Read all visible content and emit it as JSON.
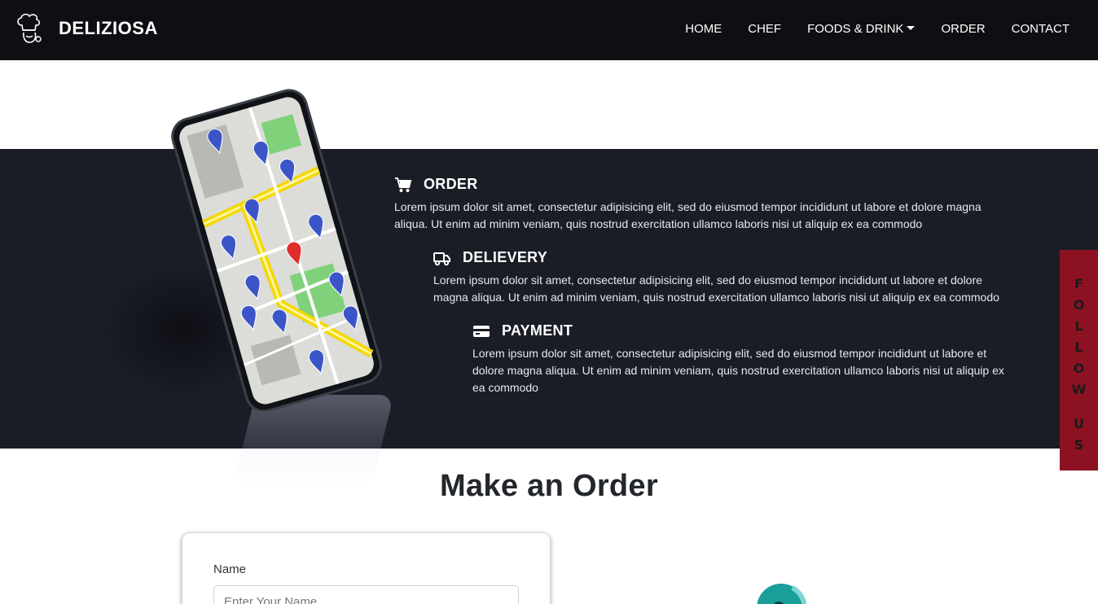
{
  "navbar": {
    "brand": "DELIZIOSA",
    "brand_icon": "chef-hat-icon",
    "links": [
      "HOME",
      "CHEF",
      "FOODS & DRINK",
      "ORDER",
      "CONTACT"
    ]
  },
  "features": [
    {
      "title": "ORDER",
      "icon": "cart-icon",
      "body": "Lorem ipsum dolor sit amet, consectetur adipisicing elit, sed do eiusmod tempor incididunt ut labore et dolore magna aliqua. Ut enim ad minim veniam, quis nostrud exercitation ullamco laboris nisi ut aliquip ex ea commodo"
    },
    {
      "title": "DELIEVERY",
      "icon": "truck-icon",
      "body": "Lorem ipsum dolor sit amet, consectetur adipisicing elit, sed do eiusmod tempor incididunt ut labore et dolore magna aliqua. Ut enim ad minim veniam, quis nostrud exercitation ullamco laboris nisi ut aliquip ex ea commodo"
    },
    {
      "title": "PAYMENT",
      "icon": "credit-card-icon",
      "body": "Lorem ipsum dolor sit amet, consectetur adipisicing elit, sed do eiusmod tempor incididunt ut labore et dolore magna aliqua. Ut enim ad minim veniam, quis nostrud exercitation ullamco laboris nisi ut aliquip ex ea commodo"
    }
  ],
  "follow": {
    "letters": [
      "F",
      "O",
      "L",
      "L",
      "O",
      "W",
      "",
      "U",
      "S"
    ]
  },
  "order_section": {
    "title": "Make an Order",
    "name_label": "Name",
    "name_placeholder": "Enter Your Name"
  },
  "colors": {
    "navbar": "#0d0f12",
    "band": "#1a1c26",
    "follow": "#8c1222",
    "accent_teal": "#1a9e9a"
  }
}
